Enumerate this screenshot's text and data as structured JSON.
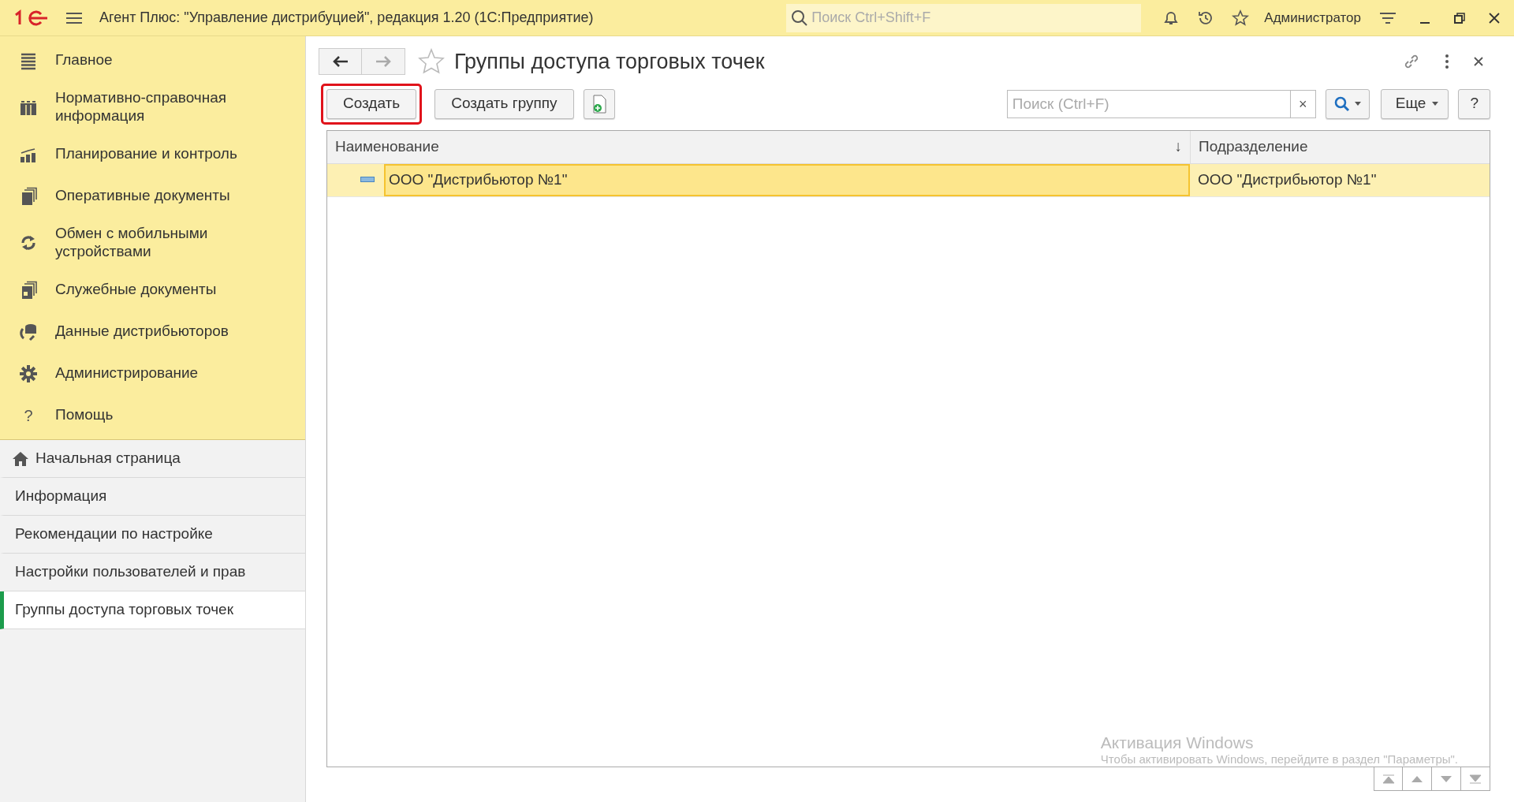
{
  "app_bar": {
    "title": "Агент Плюс: \"Управление дистрибуцией\", редакция 1.20  (1С:Предприятие)",
    "search": {
      "placeholder": "Поиск Ctrl+Shift+F"
    },
    "user": "Администратор"
  },
  "sections": [
    {
      "label": "Главное"
    },
    {
      "label": "Нормативно-справочная информация"
    },
    {
      "label": "Планирование и контроль"
    },
    {
      "label": "Оперативные документы"
    },
    {
      "label": "Обмен с мобильными устройствами"
    },
    {
      "label": "Служебные документы"
    },
    {
      "label": "Данные дистрибьюторов"
    },
    {
      "label": "Администрирование"
    },
    {
      "label": "Помощь",
      "glyph": "?"
    }
  ],
  "open_windows": [
    {
      "label": "Начальная страница",
      "home": true,
      "selected": false
    },
    {
      "label": "Информация",
      "home": false,
      "selected": false
    },
    {
      "label": "Рекомендации по настройке",
      "home": false,
      "selected": false
    },
    {
      "label": "Настройки пользователей и прав",
      "home": false,
      "selected": false
    },
    {
      "label": "Группы доступа торговых точек",
      "home": false,
      "selected": true
    }
  ],
  "form": {
    "title": "Группы доступа торговых точек",
    "toolbar": {
      "buttons": [
        {
          "kind": "text",
          "label": "Создать",
          "highlighted": true
        },
        {
          "kind": "text",
          "label": "Создать группу",
          "highlighted": false
        },
        {
          "kind": "icon",
          "highlighted": false
        }
      ],
      "search": {
        "placeholder": "Поиск (Ctrl+F)",
        "clear": "×"
      },
      "more": "Еще",
      "help": "?"
    },
    "table": {
      "columns": [
        {
          "label": "Наименование",
          "sort": "↓"
        },
        {
          "label": "Подразделение"
        }
      ],
      "rows": [
        {
          "cells": [
            "ООО \"Дистрибьютор №1\"",
            "ООО \"Дистрибьютор №1\""
          ],
          "selected": true
        }
      ]
    }
  },
  "windows_activation": {
    "title": "Активация Windows",
    "text": "Чтобы активировать Windows, перейдите в раздел \"Параметры\"."
  }
}
